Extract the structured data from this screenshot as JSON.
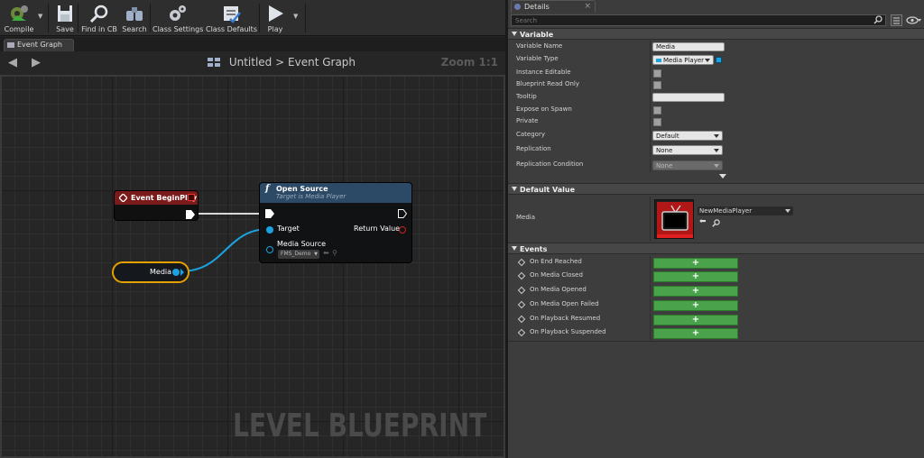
{
  "toolbar": {
    "compile": "Compile",
    "save": "Save",
    "find_in_cb": "Find in CB",
    "search": "Search",
    "class_settings": "Class Settings",
    "class_defaults": "Class Defaults",
    "play": "Play"
  },
  "tabs": {
    "event_graph": "Event Graph"
  },
  "graph": {
    "breadcrumb_root": "Untitled",
    "breadcrumb_sep": ">",
    "breadcrumb_leaf": "Event Graph",
    "zoom": "Zoom 1:1",
    "watermark": "LEVEL BLUEPRINT",
    "nodes": {
      "begin_play": {
        "title": "Event BeginPlay"
      },
      "open_source": {
        "title": "Open Source",
        "subtitle": "Target is Media Player",
        "pin_target": "Target",
        "pin_return": "Return Value",
        "pin_media_source": "Media Source",
        "media_source_value": "FMS_Demo"
      },
      "media_var": {
        "title": "Media"
      }
    }
  },
  "details": {
    "tab_title": "Details",
    "search_placeholder": "Search",
    "sections": {
      "variable": "Variable",
      "default_value": "Default Value",
      "events": "Events"
    },
    "variable": {
      "variable_name_label": "Variable Name",
      "variable_name_value": "Media",
      "variable_type_label": "Variable Type",
      "variable_type_value": "Media Player",
      "instance_editable_label": "Instance Editable",
      "read_only_label": "Blueprint Read Only",
      "tooltip_label": "Tooltip",
      "tooltip_value": "",
      "expose_label": "Expose on Spawn",
      "private_label": "Private",
      "category_label": "Category",
      "category_value": "Default",
      "replication_label": "Replication",
      "replication_value": "None",
      "replication_condition_label": "Replication Condition",
      "replication_condition_value": "None"
    },
    "default_value": {
      "media_label": "Media",
      "asset_name": "NewMediaPlayer"
    },
    "events": [
      {
        "label": "On End Reached",
        "button": "+"
      },
      {
        "label": "On Media Closed",
        "button": "+"
      },
      {
        "label": "On Media Opened",
        "button": "+"
      },
      {
        "label": "On Media Open Failed",
        "button": "+"
      },
      {
        "label": "On Playback Resumed",
        "button": "+"
      },
      {
        "label": "On Playback Suspended",
        "button": "+"
      }
    ]
  },
  "colors": {
    "event_node_header": "#7a1a1a",
    "function_node_header": "#2c4a66",
    "selection_outline": "#e5a100",
    "object_pin": "#1aa3e0",
    "add_event_button": "#4aa34a"
  }
}
